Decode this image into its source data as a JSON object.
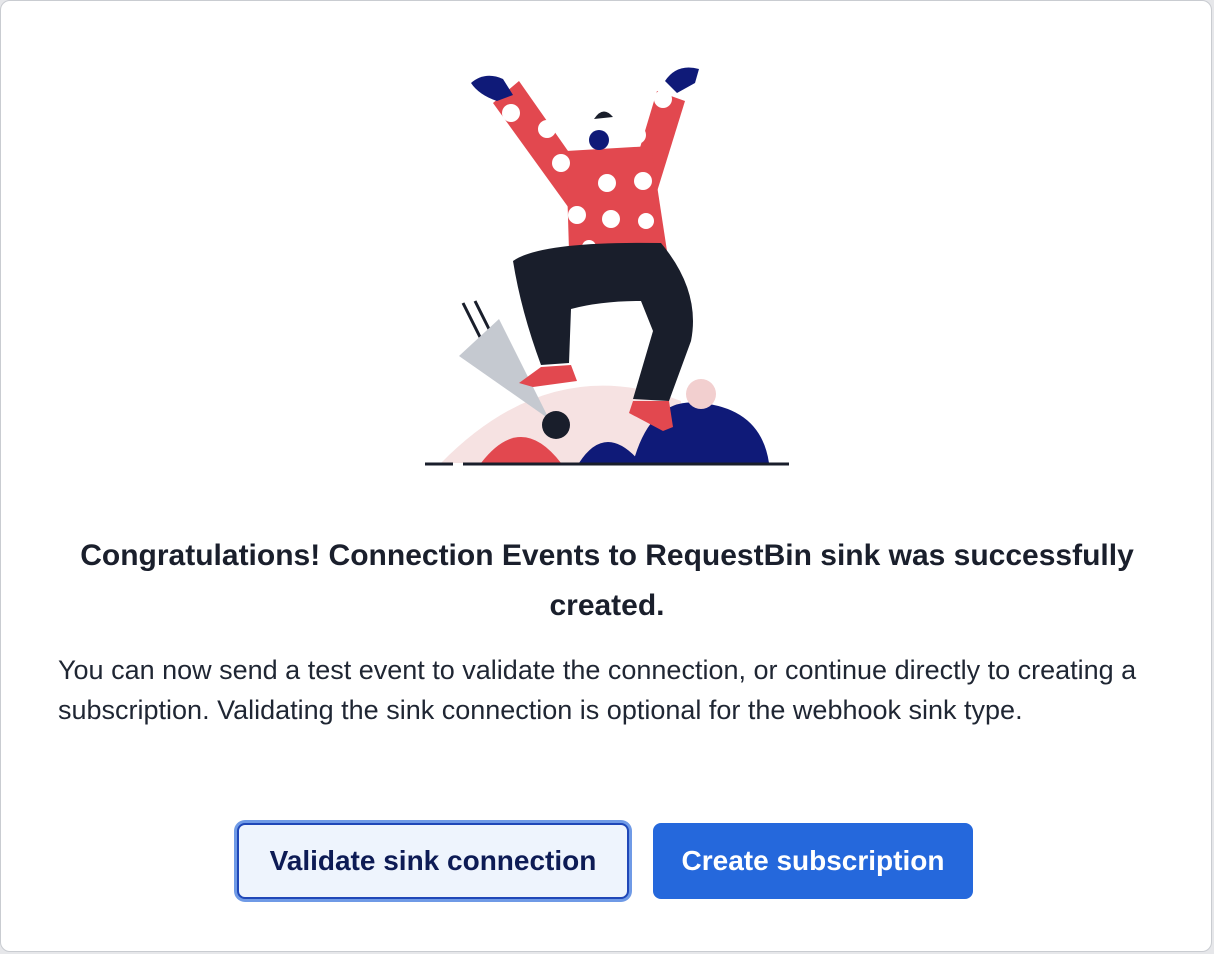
{
  "dialog": {
    "title": "Congratulations! Connection Events to RequestBin sink was successfully created.",
    "message": "You can now send a test event to validate the connection, or continue directly to creating a subscription. Validating the sink connection is optional for the webhook sink type.",
    "illustration_icon": "celebrating-person-illustration",
    "buttons": {
      "validate_label": "Validate sink connection",
      "create_label": "Create subscription"
    }
  },
  "colors": {
    "primary": "#2568dc",
    "secondary_bg": "#eef4fd",
    "text": "#1a1f2c",
    "illustration_red": "#e2484f",
    "illustration_navy": "#0f1a78",
    "illustration_dark": "#191e2b",
    "illustration_pink": "#f6e2e2"
  }
}
